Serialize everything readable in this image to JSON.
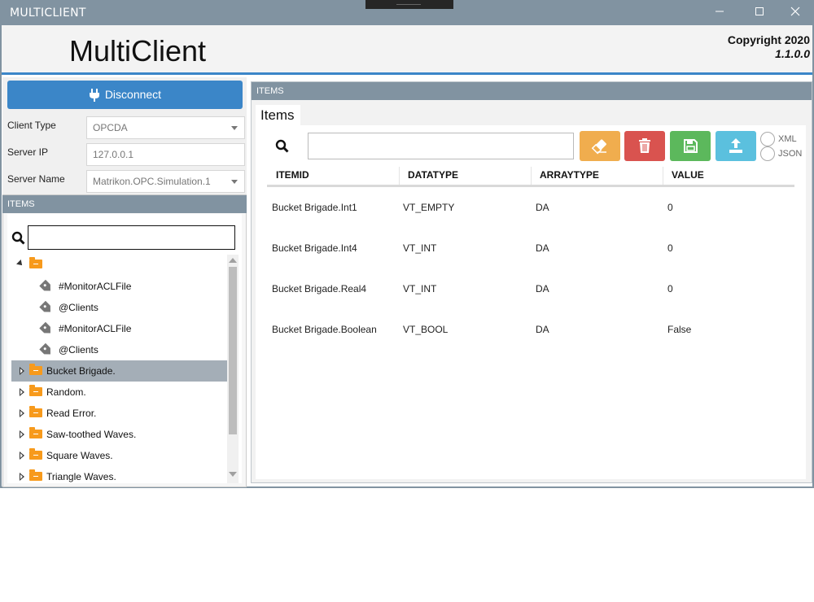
{
  "window": {
    "title": "MULTICLIENT",
    "controls": [
      "minimize",
      "maximize",
      "close"
    ]
  },
  "header": {
    "app_title": "MultiClient",
    "copyright": "Copyright 2020",
    "version": "1.1.0.0"
  },
  "connection": {
    "button_label": "Disconnect",
    "client_type_label": "Client Type",
    "client_type": "OPCDA",
    "server_ip_label": "Server IP",
    "server_ip": "127.0.0.1",
    "server_name_label": "Server Name",
    "server_name": "Matrikon.OPC.Simulation.1"
  },
  "left_items": {
    "header": "ITEMS",
    "search_value": "",
    "tree": [
      {
        "label": "",
        "kind": "folder",
        "expanded": true,
        "level": 0
      },
      {
        "label": "#MonitorACLFile",
        "kind": "tag",
        "level": 1
      },
      {
        "label": "@Clients",
        "kind": "tag",
        "level": 1
      },
      {
        "label": "#MonitorACLFile",
        "kind": "tag",
        "level": 1
      },
      {
        "label": "@Clients",
        "kind": "tag",
        "level": 1
      },
      {
        "label": "Bucket Brigade.",
        "kind": "folder",
        "expanded": false,
        "selected": true,
        "level": 0
      },
      {
        "label": "Random.",
        "kind": "folder",
        "expanded": false,
        "level": 0
      },
      {
        "label": "Read Error.",
        "kind": "folder",
        "expanded": false,
        "level": 0
      },
      {
        "label": "Saw-toothed Waves.",
        "kind": "folder",
        "expanded": false,
        "level": 0
      },
      {
        "label": "Square Waves.",
        "kind": "folder",
        "expanded": false,
        "level": 0
      },
      {
        "label": "Triangle Waves.",
        "kind": "folder",
        "expanded": false,
        "level": 0
      }
    ]
  },
  "right_items": {
    "header": "ITEMS",
    "tab_label": "Items",
    "search_value": "",
    "toolbar": {
      "clear_color": "#f0ad4e",
      "delete_color": "#d9534f",
      "save_color": "#5cb85c",
      "export_color": "#5bc0de"
    },
    "format_options": [
      "XML",
      "JSON"
    ],
    "columns": [
      "ITEMID",
      "DATATYPE",
      "ARRAYTYPE",
      "VALUE"
    ],
    "rows": [
      [
        "Bucket Brigade.Int1",
        "VT_EMPTY",
        "DA",
        "0"
      ],
      [
        "Bucket Brigade.Int4",
        "VT_INT",
        "DA",
        "0"
      ],
      [
        "Bucket Brigade.Real4",
        "VT_INT",
        "DA",
        "0"
      ],
      [
        "Bucket Brigade.Boolean",
        "VT_BOOL",
        "DA",
        "False"
      ]
    ]
  },
  "colors": {
    "accent": "#3b86c8",
    "titlebar": "#8193a1",
    "folder": "#f79a1c",
    "selected_row": "#a4aeb7"
  }
}
